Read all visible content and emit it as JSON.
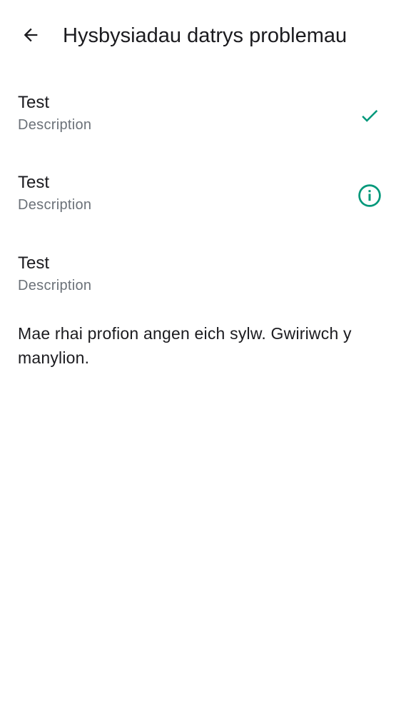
{
  "app_bar": {
    "back_icon": "arrow-left-icon",
    "title": "Hysbysiadau datrys problemau"
  },
  "tests": [
    {
      "title": "Test",
      "description": "Description",
      "status": "passed",
      "status_icon": "check-icon",
      "status_color": "#00987a"
    },
    {
      "title": "Test",
      "description": "Description",
      "status": "info",
      "status_icon": "info-icon",
      "status_color": "#00987a"
    },
    {
      "title": "Test",
      "description": "Description",
      "status": "none",
      "status_icon": ""
    }
  ],
  "message": "Mae rhai profion angen eich sylw. Gwiriwch y manylion.",
  "colors": {
    "accent": "#00987a",
    "text_primary": "#1b1b1f",
    "text_secondary": "#6b7178",
    "background": "#ffffff"
  }
}
